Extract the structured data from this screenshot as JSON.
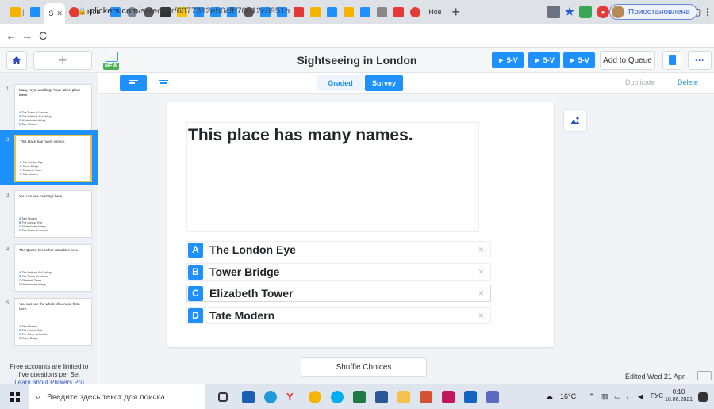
{
  "browser": {
    "tab_labels": [
      "Нов",
      "Нов"
    ],
    "url_host": "plickers.com",
    "url_path": "/seteditor/6077392eb6cfb70012c6951b",
    "profile_label": "Приостановлена"
  },
  "header": {
    "new_badge": "NEW",
    "set_title": "Sightseeing in London",
    "play_buttons": [
      "► 5-V",
      "► 5-V",
      "► 5-V"
    ],
    "add_to_queue": "Add to Queue",
    "more": "···"
  },
  "sidebar": {
    "slides": [
      {
        "num": "1",
        "text": "Many royal weddings have taken place there.",
        "choices": [
          "The Tower of London",
          "The National Art Gallery",
          "Westminster Abbey",
          "Tate Modern"
        ]
      },
      {
        "num": "2",
        "text": "This place has many names.",
        "choices": [
          "The London Eye",
          "Tower Bridge",
          "Elizabeth Tower",
          "Tate Modern"
        ]
      },
      {
        "num": "3",
        "text": "You can see paintings here.",
        "choices": [
          "Tate Modern",
          "The London Eye",
          "Westminster Abbey",
          "The Tower of London"
        ]
      },
      {
        "num": "4",
        "text": "The Queen keeps her valuables here.",
        "choices": [
          "The National Art Gallery",
          "The Tower of London",
          "Elizabeth Tower",
          "Westminster Abbey"
        ]
      },
      {
        "num": "5",
        "text": "You can see the whole of London from here.",
        "choices": [
          "Tate Modern",
          "The London Eye",
          "The Tower of London",
          "Tower Bridge"
        ]
      }
    ],
    "footer_line1": "Free accounts are limited to",
    "footer_line2": "five questions per Set",
    "footer_link": "Learn about Plickers Pro"
  },
  "toolbar": {
    "graded": "Graded",
    "survey": "Survey",
    "duplicate": "Duplicate",
    "delete": "Delete"
  },
  "question": {
    "text": "This place has many names.",
    "choices": [
      {
        "letter": "A",
        "text": "The London Eye"
      },
      {
        "letter": "B",
        "text": "Tower Bridge"
      },
      {
        "letter": "C",
        "text": "Elizabeth Tower"
      },
      {
        "letter": "D",
        "text": "Tate Modern"
      }
    ],
    "remove_glyph": "×"
  },
  "footer": {
    "shuffle": "Shuffle Choices",
    "edited": "Edited Wed 21 Apr"
  },
  "taskbar": {
    "search_placeholder": "Введите здесь текст для поиска",
    "temperature": "16°C",
    "lang": "РУС",
    "time": "0:10",
    "date": "10.06.2021"
  },
  "colors": {
    "accent": "#1e90ff",
    "selected_border": "#e5c642",
    "new_badge": "#4caf50"
  }
}
